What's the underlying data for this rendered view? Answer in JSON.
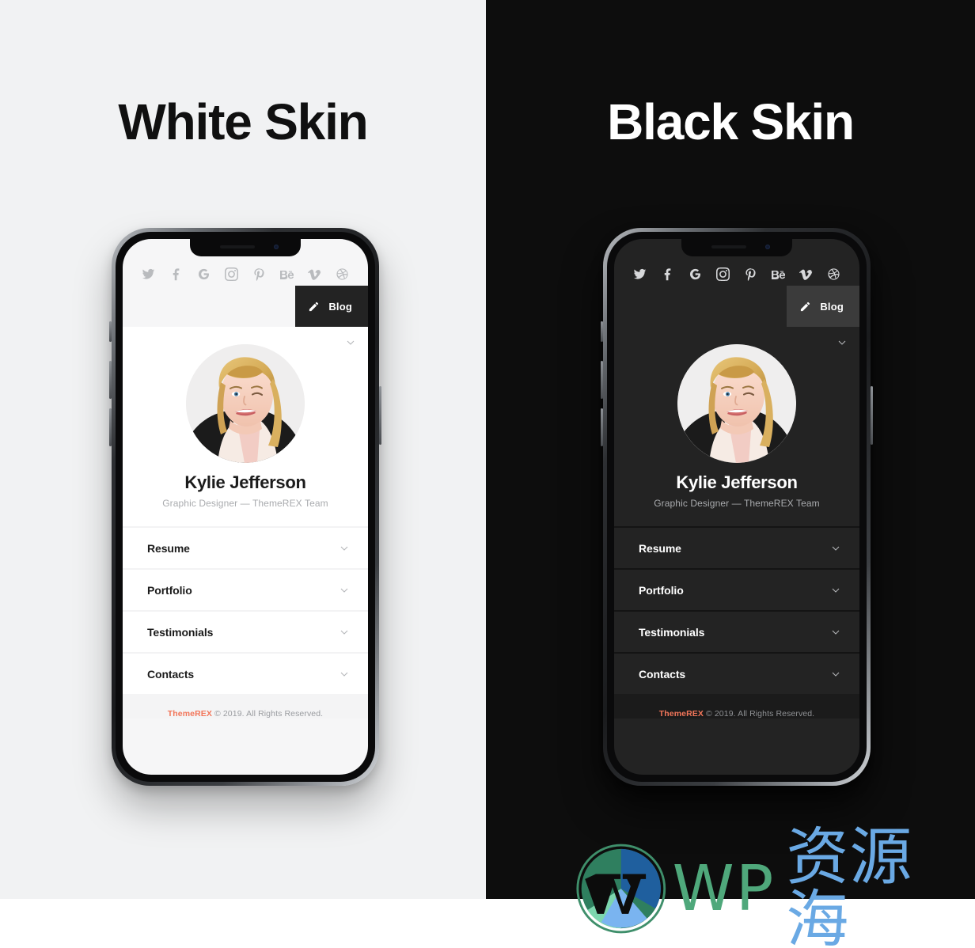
{
  "panels": [
    {
      "id": "white-skin",
      "title": "White Skin",
      "bg_color": "#f1f2f3",
      "title_color": "#101010"
    },
    {
      "id": "black-skin",
      "title": "Black Skin",
      "bg_color": "#0d0d0d",
      "title_color": "#ffffff"
    }
  ],
  "phone": {
    "social_icons": [
      {
        "name": "twitter-icon",
        "label": "Twitter"
      },
      {
        "name": "facebook-icon",
        "label": "Facebook"
      },
      {
        "name": "google-icon",
        "label": "Google"
      },
      {
        "name": "instagram-icon",
        "label": "Instagram"
      },
      {
        "name": "pinterest-icon",
        "label": "Pinterest"
      },
      {
        "name": "behance-icon",
        "label": "Be"
      },
      {
        "name": "vimeo-icon",
        "label": "Vimeo"
      },
      {
        "name": "dribbble-icon",
        "label": "Dribbble"
      }
    ],
    "blog_button": {
      "label": "Blog",
      "icon": "pencil-icon",
      "bg_light": "#232323",
      "bg_dark": "#3b3b3b"
    },
    "profile": {
      "name": "Kylie Jefferson",
      "role": "Graphic Designer — ThemeREX Team",
      "avatar_alt": "Kylie Jefferson portrait",
      "collapse_icon": "chevron-down-icon"
    },
    "menu": [
      {
        "label": "Resume",
        "icon": "chevron-down-icon"
      },
      {
        "label": "Portfolio",
        "icon": "chevron-down-icon"
      },
      {
        "label": "Testimonials",
        "icon": "chevron-down-icon"
      },
      {
        "label": "Contacts",
        "icon": "chevron-down-icon"
      }
    ],
    "footer": {
      "brand": "ThemeREX",
      "brand_color": "#f2765a",
      "text": " © 2019. All Rights Reserved."
    }
  },
  "watermark": {
    "logo": "wordpress-logo",
    "text_en": "WP",
    "text_cn": "资源海",
    "color_en": "#4fa87b",
    "color_cn": "#6aa9e4"
  }
}
